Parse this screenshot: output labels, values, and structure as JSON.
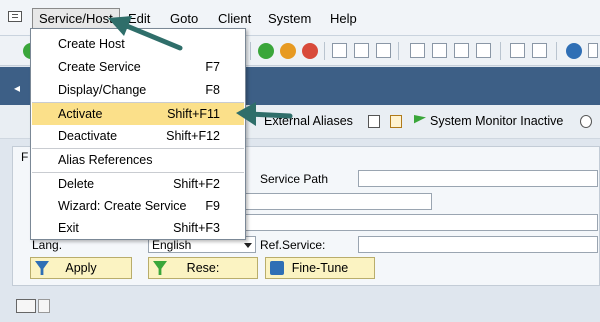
{
  "menubar": {
    "items": [
      {
        "label": "Service/Host",
        "active": true
      },
      {
        "label": "Edit"
      },
      {
        "label": "Goto"
      },
      {
        "label": "Client"
      },
      {
        "label": "System"
      },
      {
        "label": "Help"
      }
    ]
  },
  "service_menu": {
    "items": [
      {
        "label": "Create Host",
        "shortcut": ""
      },
      {
        "label": "Create Service",
        "shortcut": "F7"
      },
      {
        "label": "Display/Change",
        "shortcut": "F8"
      },
      {
        "label": "Activate",
        "shortcut": "Shift+F11",
        "highlighted": true
      },
      {
        "label": "Deactivate",
        "shortcut": "Shift+F12"
      },
      {
        "label": "Alias References",
        "shortcut": ""
      },
      {
        "label": "Delete",
        "shortcut": "Shift+F2"
      },
      {
        "label": "Wizard: Create Service",
        "shortcut": "F9"
      },
      {
        "label": "Exit",
        "shortcut": "Shift+F3"
      }
    ]
  },
  "app_toolbar": {
    "external_aliases": "External Aliases",
    "system_monitor": "System Monitor Inactive"
  },
  "form": {
    "panel_label": "F",
    "service_path_label": "Service Path",
    "service_path_value": "",
    "lang_label": "Lang.",
    "lang_value": "English",
    "ref_service_label": "Ref.Service:",
    "ref_service_value": ""
  },
  "buttons": {
    "apply": "Apply",
    "reset": "Rese:",
    "fine_tune": "Fine-Tune"
  },
  "colors": {
    "title_bar": "#3d5f86",
    "highlight": "#fbe08a",
    "annotation_arrow": "#2f6e6a",
    "button_bg": "#fbf3c2"
  }
}
